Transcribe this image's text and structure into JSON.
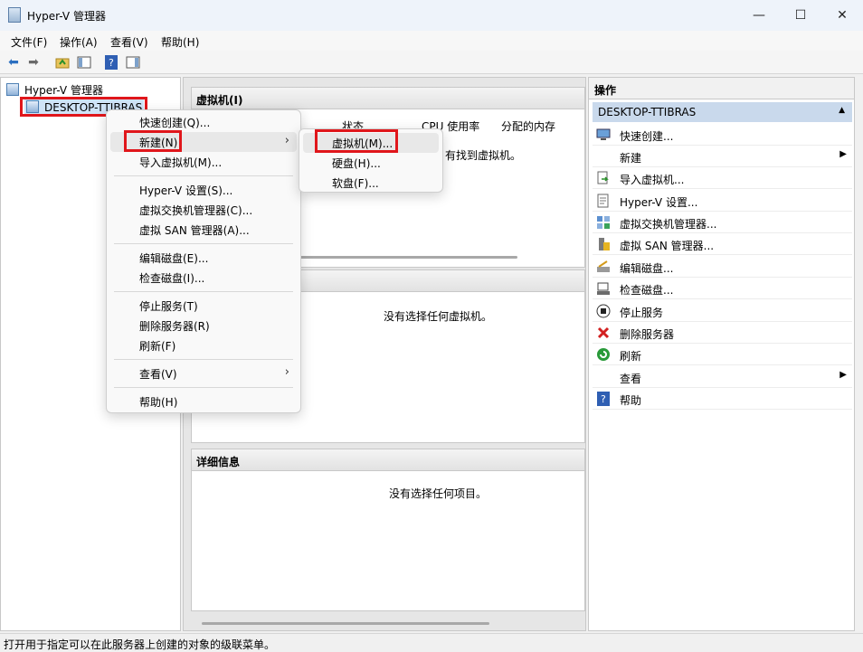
{
  "window": {
    "title": "Hyper-V 管理器",
    "controls": [
      "—",
      "☐",
      "✕"
    ]
  },
  "menubar": [
    "文件(F)",
    "操作(A)",
    "查看(V)",
    "帮助(H)"
  ],
  "tree": {
    "root": "Hyper-V 管理器",
    "server": "DESKTOP-TTIBRAS"
  },
  "vm_section": {
    "title": "虚拟机(I)",
    "columns": [
      "状态",
      "CPU 使用率",
      "分配的内存"
    ],
    "empty_fragment": "有找到虚拟机。"
  },
  "checkpoint_empty": "没有选择任何虚拟机。",
  "details": {
    "title": "详细信息",
    "empty": "没有选择任何项目。"
  },
  "context_menu": {
    "items": [
      {
        "label": "快速创建(Q)..."
      },
      {
        "label": "新建(N)",
        "submenu": true
      },
      {
        "label": "导入虚拟机(M)..."
      },
      {
        "label": "Hyper-V 设置(S)..."
      },
      {
        "label": "虚拟交换机管理器(C)..."
      },
      {
        "label": "虚拟 SAN 管理器(A)..."
      },
      {
        "label": "编辑磁盘(E)..."
      },
      {
        "label": "检查磁盘(I)..."
      },
      {
        "label": "停止服务(T)"
      },
      {
        "label": "删除服务器(R)"
      },
      {
        "label": "刷新(F)"
      },
      {
        "label": "查看(V)",
        "submenu": true
      },
      {
        "label": "帮助(H)"
      }
    ],
    "submenu_arrow": "›"
  },
  "submenu": [
    "虚拟机(M)...",
    "硬盘(H)...",
    "软盘(F)..."
  ],
  "actions": {
    "title": "操作",
    "group": "DESKTOP-TTIBRAS",
    "items": [
      {
        "label": "快速创建...",
        "icon": "quick-create-icon"
      },
      {
        "label": "新建",
        "icon": "none",
        "submenu": true
      },
      {
        "label": "导入虚拟机...",
        "icon": "import-icon"
      },
      {
        "label": "Hyper-V 设置...",
        "icon": "settings-icon"
      },
      {
        "label": "虚拟交换机管理器...",
        "icon": "switch-icon"
      },
      {
        "label": "虚拟 SAN 管理器...",
        "icon": "san-icon"
      },
      {
        "label": "编辑磁盘...",
        "icon": "edit-disk-icon"
      },
      {
        "label": "检查磁盘...",
        "icon": "inspect-disk-icon"
      },
      {
        "label": "停止服务",
        "icon": "stop-icon"
      },
      {
        "label": "删除服务器",
        "icon": "delete-icon"
      },
      {
        "label": "刷新",
        "icon": "refresh-icon"
      },
      {
        "label": "查看",
        "icon": "none",
        "submenu": true
      },
      {
        "label": "帮助",
        "icon": "help-icon"
      }
    ]
  },
  "status": "打开用于指定可以在此服务器上创建的对象的级联菜单。",
  "colors": {
    "highlight": "#e0161b",
    "actions_group_bg": "#c9d9ec"
  }
}
